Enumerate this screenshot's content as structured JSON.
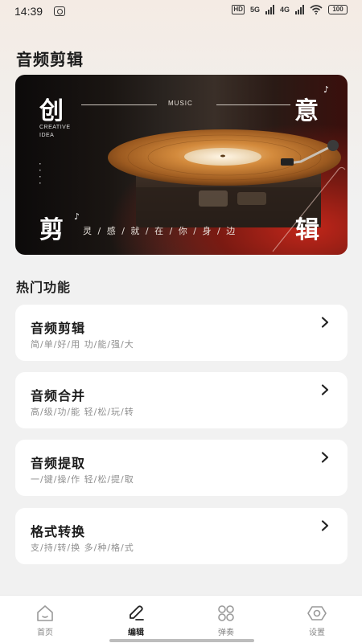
{
  "status_bar": {
    "time": "14:39",
    "network_5g": "5G",
    "network_4g": "4G",
    "hd_label": "HD",
    "battery": "100"
  },
  "page_title": "音频剪辑",
  "banner": {
    "char_top_left": "创",
    "char_top_right": "意",
    "char_bottom_left": "剪",
    "char_bottom_right": "辑",
    "music_label": "MUSIC",
    "creative_line1": "CREATIVE",
    "creative_line2": "IDEA",
    "slogan": "灵 / 感 / 就 / 在 / 你 / 身 / 边",
    "note_symbol": "♪"
  },
  "section_title": "热门功能",
  "features": [
    {
      "title": "音频剪辑",
      "desc": "简/单/好/用 功/能/强/大"
    },
    {
      "title": "音频合并",
      "desc": "高/级/功/能 轻/松/玩/转"
    },
    {
      "title": "音频提取",
      "desc": "一/键/操/作 轻/松/提/取"
    },
    {
      "title": "格式转换",
      "desc": "支/持/转/换 多/种/格/式"
    }
  ],
  "nav": [
    {
      "label": "首页",
      "icon": "home-icon"
    },
    {
      "label": "编辑",
      "icon": "edit-icon"
    },
    {
      "label": "弹奏",
      "icon": "grid-icon"
    },
    {
      "label": "设置",
      "icon": "settings-icon"
    }
  ],
  "nav_active_index": 1,
  "colors": {
    "card_bg": "#ffffff",
    "page_bg": "#f1f1f1",
    "banner_red": "#c2261a",
    "record_orange": "#c9772e"
  }
}
